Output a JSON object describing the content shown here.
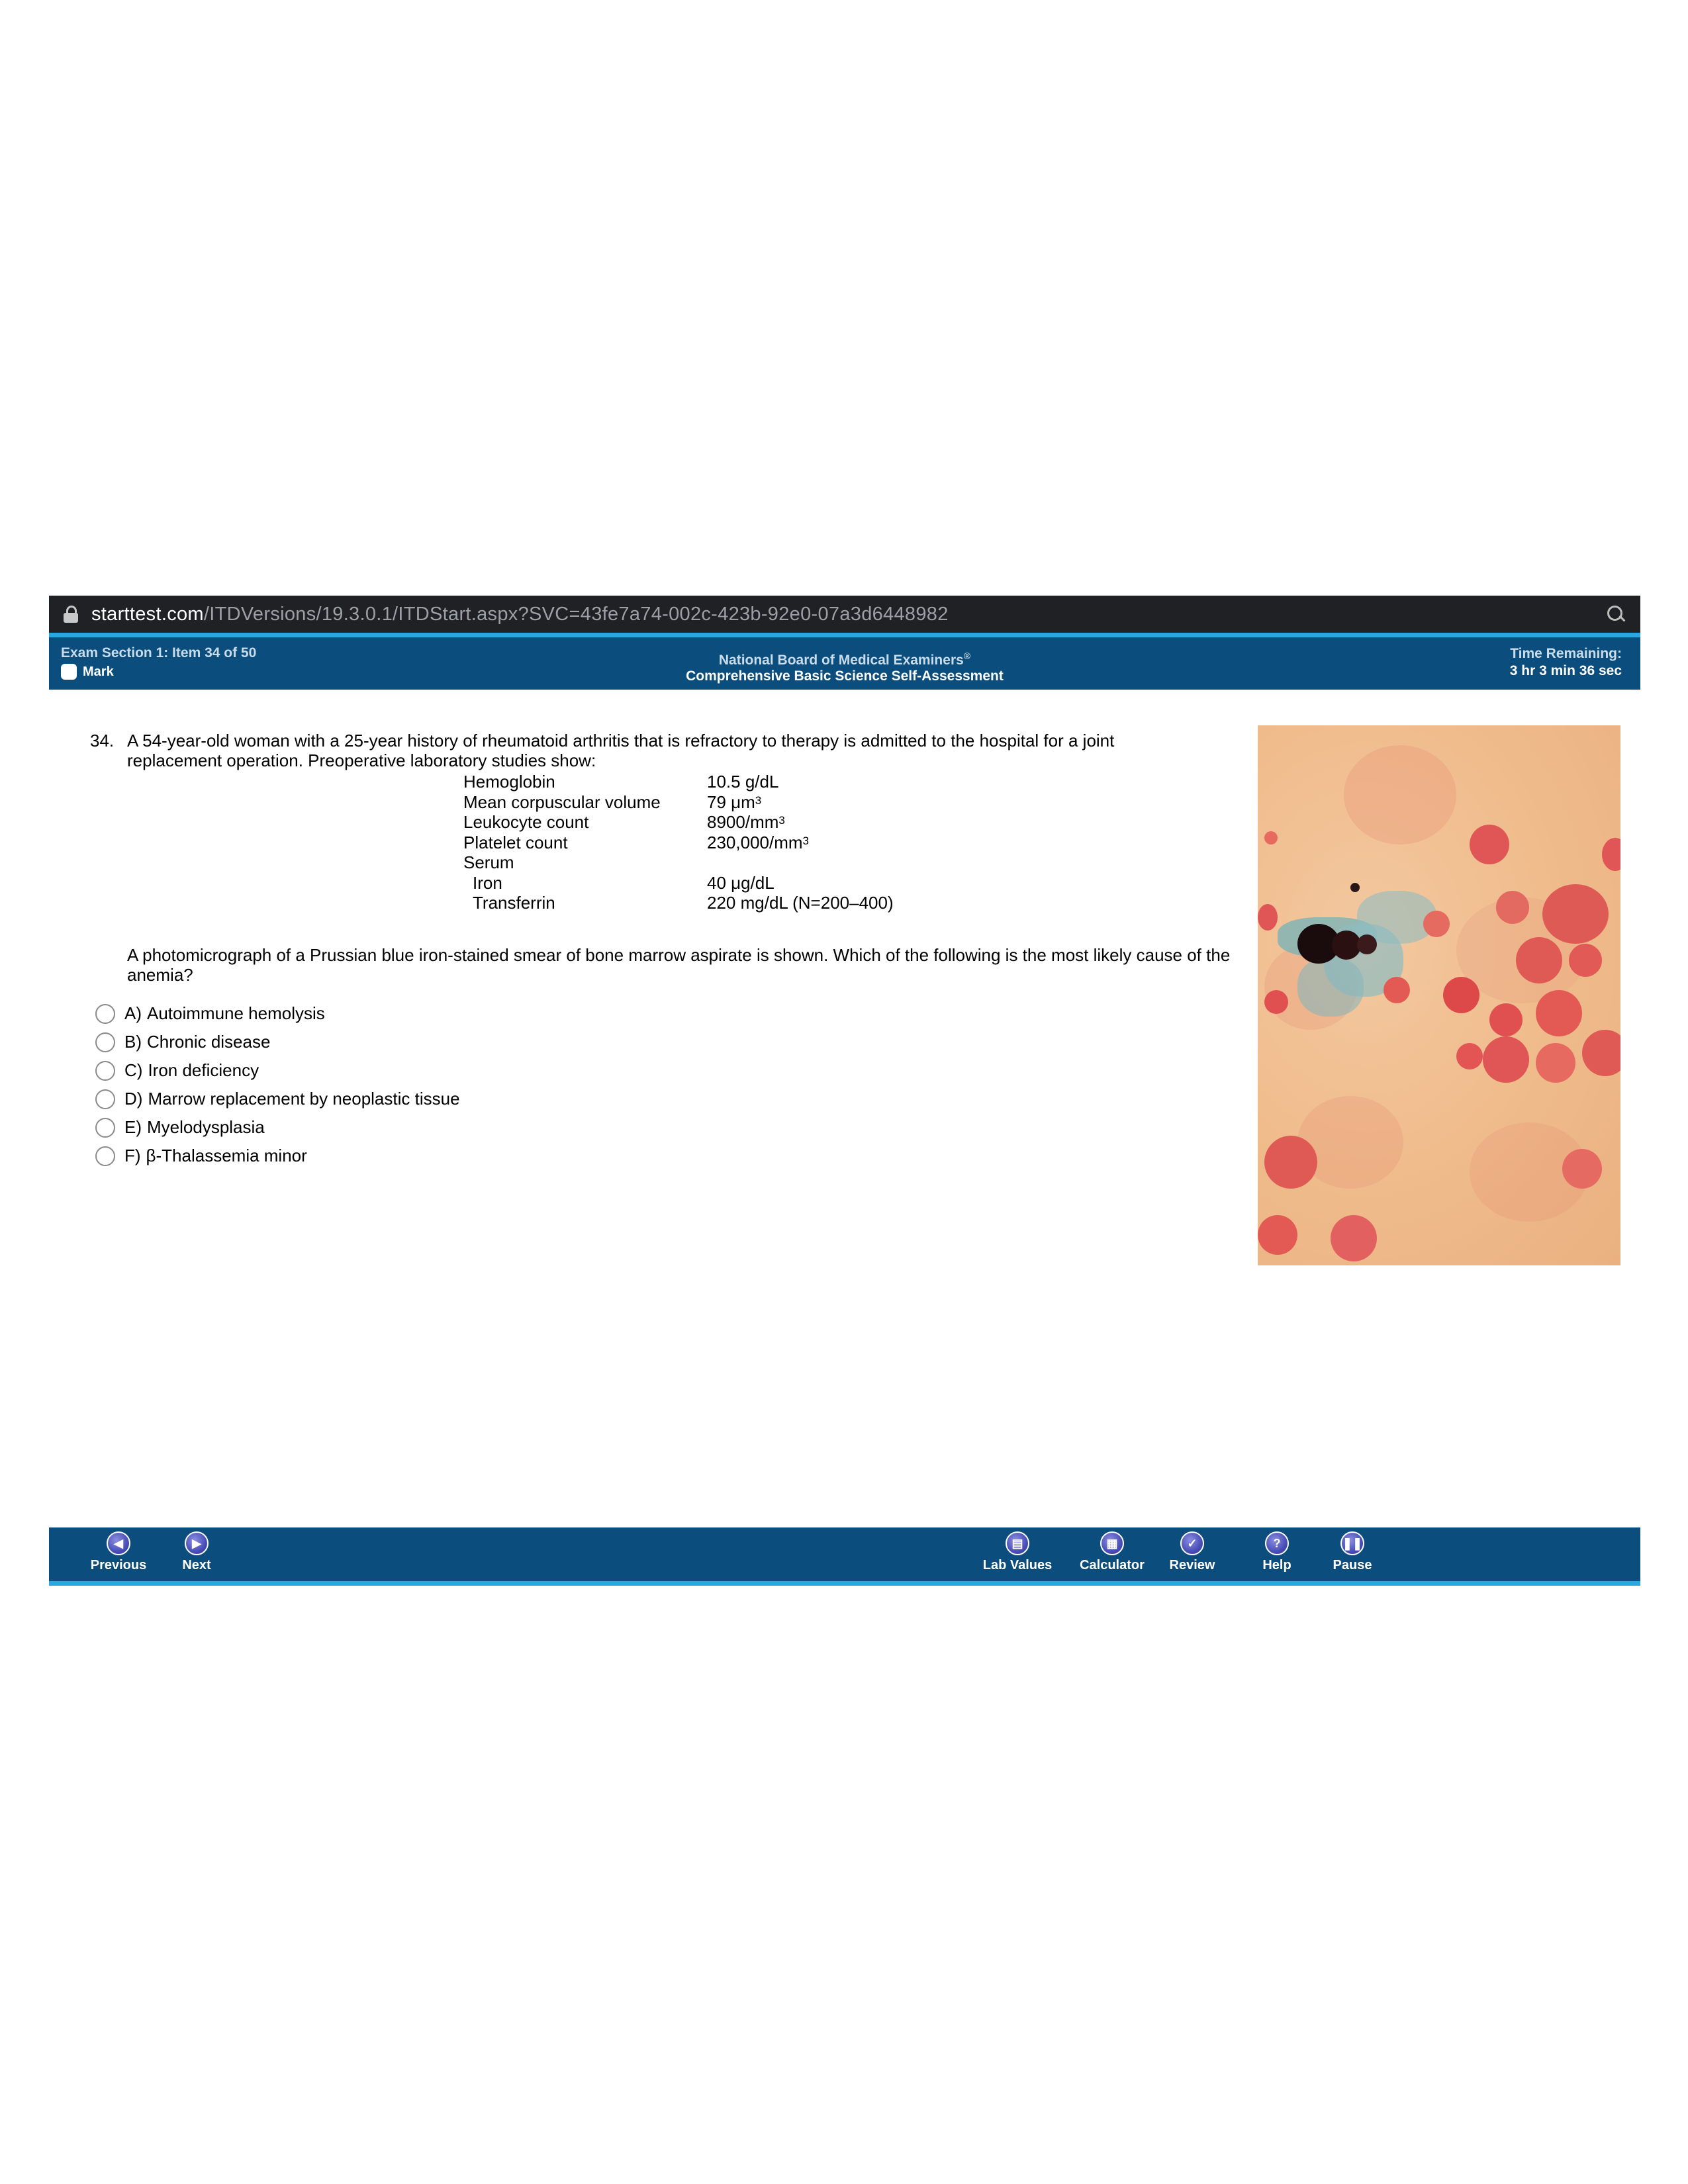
{
  "browser": {
    "url_host": "starttest.com",
    "url_path": "/ITDVersions/19.3.0.1/ITDStart.aspx?SVC=43fe7a74-002c-423b-92e0-07a3d6448982"
  },
  "header": {
    "section": "Exam Section 1: Item 34 of 50",
    "mark_label": "Mark",
    "org": "National Board of Medical Examiners",
    "registered_mark": "®",
    "exam_name": "Comprehensive Basic Science Self-Assessment",
    "time_label": "Time Remaining:",
    "time_value": "3 hr 3 min 36 sec"
  },
  "question": {
    "number": "34.",
    "stem": "A 54-year-old woman with a 25-year history of rheumatoid arthritis that is refractory to therapy is admitted to the hospital for a joint replacement operation. Preoperative laboratory studies show:",
    "labs": [
      {
        "name": "Hemoglobin",
        "value": "10.5 g/dL",
        "sup": ""
      },
      {
        "name": "Mean corpuscular volume",
        "value": "79 μm",
        "sup": "3"
      },
      {
        "name": "Leukocyte count",
        "value": "8900/mm",
        "sup": "3"
      },
      {
        "name": "Platelet count",
        "value": "230,000/mm",
        "sup": "3"
      },
      {
        "name": "Serum",
        "value": "",
        "sup": ""
      },
      {
        "name": "Iron",
        "value": "40 μg/dL",
        "sup": ""
      },
      {
        "name": "Transferrin",
        "value": "220 mg/dL (N=200–400)",
        "sup": ""
      }
    ],
    "prompt": "A photomicrograph of a Prussian blue iron-stained smear of bone marrow aspirate is shown. Which of the following is the most likely cause of the anemia?",
    "choices": [
      {
        "letter": "A)",
        "text": "Autoimmune hemolysis"
      },
      {
        "letter": "B)",
        "text": "Chronic disease"
      },
      {
        "letter": "C)",
        "text": "Iron deficiency"
      },
      {
        "letter": "D)",
        "text": "Marrow replacement by neoplastic tissue"
      },
      {
        "letter": "E)",
        "text": "Myelodysplasia"
      },
      {
        "letter": "F)",
        "text": "β-Thalassemia minor"
      }
    ]
  },
  "footer": {
    "previous": "Previous",
    "next": "Next",
    "lab_values": "Lab Values",
    "calculator": "Calculator",
    "review": "Review",
    "help": "Help",
    "pause": "Pause"
  },
  "colors": {
    "header_bg": "#0b4d7c",
    "accent_cyan": "#27a8e0",
    "url_bar_bg": "#202124"
  },
  "icons": [
    "lock-icon",
    "zoom-icon",
    "previous-icon",
    "next-icon",
    "lab-values-icon",
    "calculator-icon",
    "review-icon",
    "help-icon",
    "pause-icon"
  ]
}
